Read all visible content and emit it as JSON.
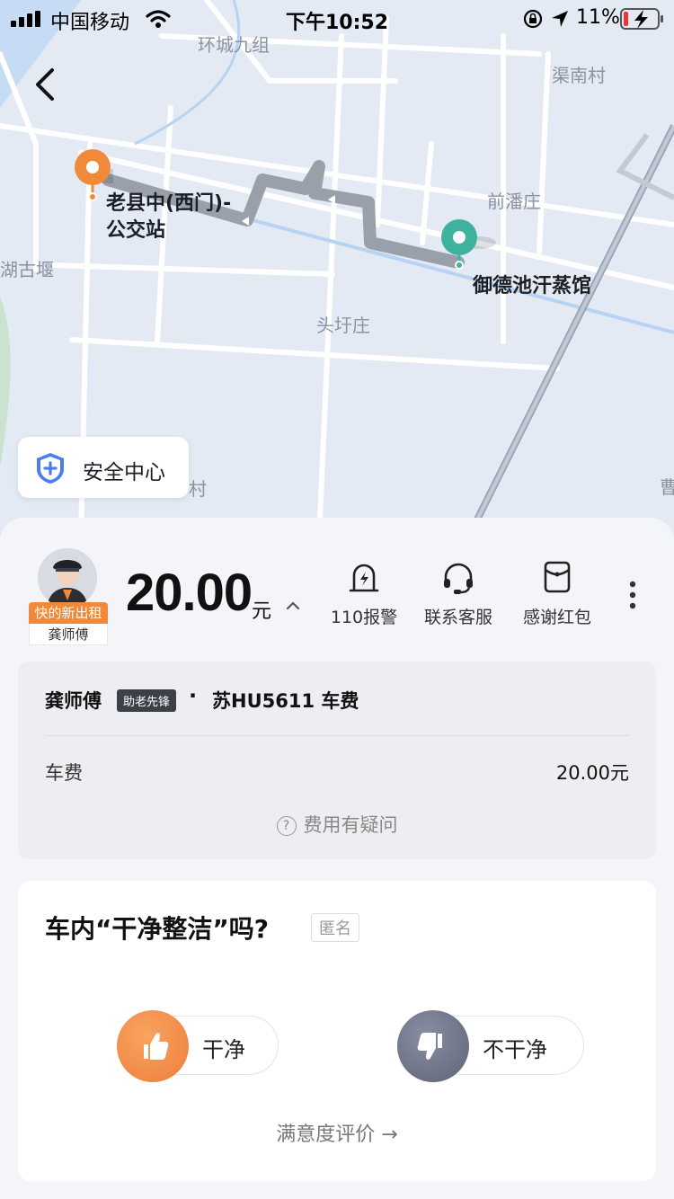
{
  "status_bar": {
    "carrier": "中国移动",
    "time": "下午10:52",
    "battery": "11%"
  },
  "map": {
    "labels": {
      "huancheng": "环城九组",
      "qunan": "渠南村",
      "qianpan": "前潘庄",
      "hugu": "湖古堰",
      "touyu": "头圩庄",
      "cun": "村",
      "cao": "曹"
    },
    "start_stop_line1": "老县中(西门)-",
    "start_stop_line2": "公交站",
    "end_stop": "御德池汗蒸馆"
  },
  "safety_center": {
    "label": "安全中心"
  },
  "driver": {
    "badge": "快的新出租",
    "name": "龚师傅"
  },
  "fare": {
    "amount": "20.00",
    "unit": "元"
  },
  "actions": [
    {
      "label": "110报警",
      "icon": "alarm-icon"
    },
    {
      "label": "联系客服",
      "icon": "headset-icon"
    },
    {
      "label": "感谢红包",
      "icon": "red-envelope-icon"
    }
  ],
  "fee_card": {
    "driver_name": "龚师傅",
    "tag": "助老先锋",
    "separator": "·",
    "plate_fare": "苏HU5611 车费",
    "row_label": "车费",
    "row_value": "20.00元",
    "question_mark": "?",
    "doubt_link": "费用有疑问"
  },
  "rating": {
    "question": "车内“干净整洁”吗?",
    "anonymous": "匿名",
    "clean": "干净",
    "not_clean": "不干净",
    "satisfaction_link": "满意度评价 →"
  },
  "colors": {
    "orange": "#f08a3a",
    "green": "#3db39e",
    "route": "#9aa0a9",
    "map_bg": "#e4eaf3"
  }
}
